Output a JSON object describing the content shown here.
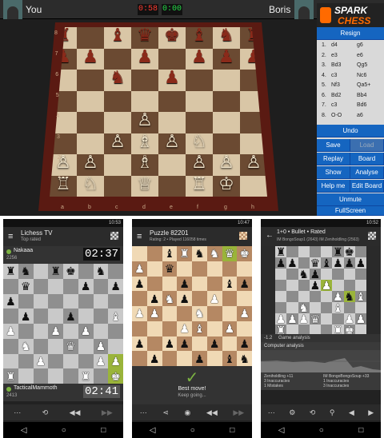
{
  "colors": {
    "accent": "#1565c0",
    "brand": "#ff6a00",
    "move_highlight": "#9ab43a"
  },
  "top": {
    "player_you": "You",
    "player_opp": "Boris",
    "clock_you": "0:58",
    "clock_opp": "0:00",
    "logo_line1": "SPARK",
    "logo_line2": "CHESS",
    "resign": "Resign",
    "moves": [
      {
        "n": "1.",
        "w": "d4",
        "b": "g6"
      },
      {
        "n": "2.",
        "w": "e3",
        "b": "e6"
      },
      {
        "n": "3.",
        "w": "Bd3",
        "b": "Qg5"
      },
      {
        "n": "4.",
        "w": "c3",
        "b": "Nc6"
      },
      {
        "n": "5.",
        "w": "Nf3",
        "b": "Qa5+"
      },
      {
        "n": "6.",
        "w": "Bd2",
        "b": "Bb4"
      },
      {
        "n": "7.",
        "w": "c3",
        "b": "Bd6"
      },
      {
        "n": "8.",
        "w": "O-O",
        "b": "a6"
      }
    ],
    "buttons": {
      "undo": "Undo",
      "save": "Save",
      "load": "Load",
      "replay": "Replay",
      "board_style": "Board Style",
      "show_coach": "Show Coach",
      "analyse": "Analyse",
      "help_me": "Help me",
      "edit_board": "Edit Board",
      "unmute": "Unmute",
      "fullscreen": "FullScreen"
    },
    "ranks": [
      "8",
      "7",
      "6",
      "5",
      "4",
      "3",
      "2",
      "1"
    ],
    "files": [
      "a",
      "b",
      "c",
      "d",
      "e",
      "f",
      "g",
      "h"
    ],
    "board": [
      "r.bqkbnr",
      "pp.p.ppp",
      "..n.p...",
      "........",
      "...P....",
      "..PBPN..",
      "PP.B.PPP",
      "RN.Q.RK."
    ]
  },
  "p1": {
    "time": "10:53",
    "title": "Lichess TV",
    "subtitle": "Top rated",
    "opp_name": "Nakaaa",
    "opp_rating": "2256",
    "opp_clock": "02:37",
    "me_name": "TacticalMammoth",
    "me_rating": "2413",
    "me_clock": "02:41",
    "board": [
      "rn.rk.n.",
      ".q...p.p",
      "p.......",
      ".p..p..B",
      "P..P.P..",
      ".N..Q.P.",
      "..P...PP",
      "R....R.K"
    ]
  },
  "p2": {
    "time": "10:47",
    "title": "Puzzle 82201",
    "subtitle": "Rating: 2 • Played 116058 times",
    "result_title": "Best move!",
    "result_sub": "Keep going...",
    "board": [
      "..bRnNQK",
      "P.q.....",
      "p..p..bp",
      ".pNp.P..",
      "PP..N..P",
      "...PB.P.",
      "p.pp.p.p",
      ".p..p.bn"
    ]
  },
  "p3": {
    "time": "10:52",
    "title": "1+0 • Bullet • Rated",
    "subtitle": "IM BongoSoup1 (2643)  IM Zeniholdling (2563)",
    "graph_tab": "Game analysis",
    "analysis_label": "Computer analysis",
    "eval": "-1.2",
    "stats_left": [
      "Zeniholdling +11",
      "3  Inaccuracies",
      "1  Mistakes"
    ],
    "stats_right": [
      "IM BongoBongoSoup +33",
      "1  Inaccuracies",
      "3  Inaccuracies"
    ],
    "board": [
      "r....rk.",
      "pp.qbppp",
      "..np....",
      "...pP...",
      ".....PnB",
      "..N..B..",
      "PPPQ..PP",
      "R....RK."
    ]
  },
  "nav": {
    "back": "◁",
    "home": "○",
    "recent": "□"
  }
}
